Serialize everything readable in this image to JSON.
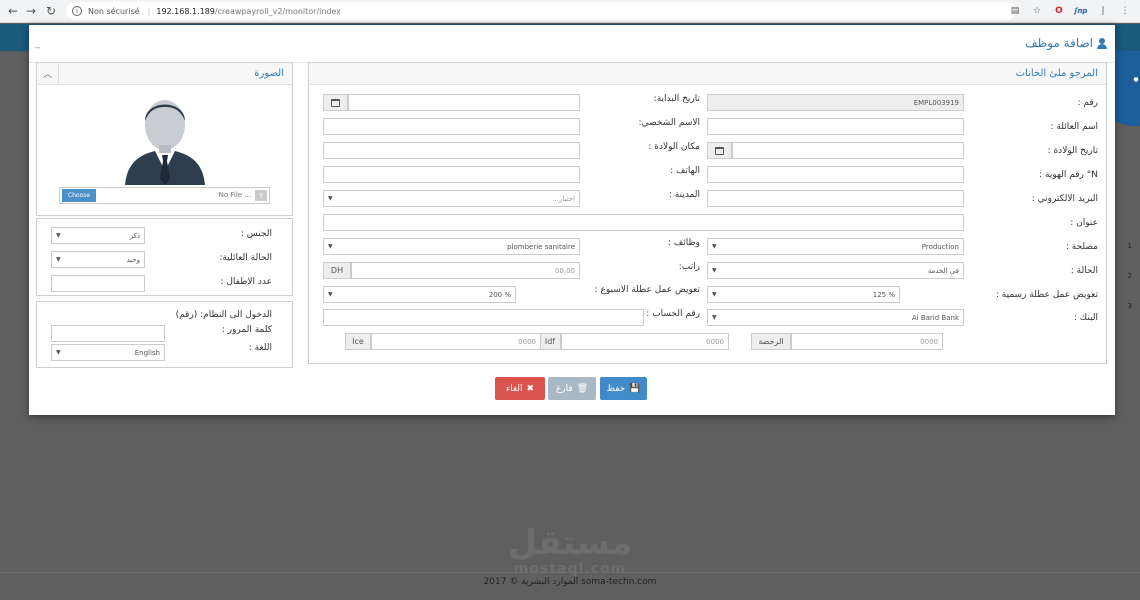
{
  "browser": {
    "back": "←",
    "forward": "→",
    "reload": "↻",
    "insecure": "Non sécurisé",
    "host": "192.168.1.189",
    "path": "/creawpayroll_v2/monitor/index"
  },
  "background": {
    "footer_text": "الموارد البشرية © 2017 soma-techn.com",
    "side_numbers": [
      "1",
      "2",
      "3"
    ],
    "watermark_ar": "مستقل",
    "watermark_lat": "mostaql.com"
  },
  "modal": {
    "title": "اضافة موظف",
    "minimize": "_",
    "main_panel_title": "المرجو ملئ الخانات",
    "photo_panel_title": "الصورة",
    "choose_label": "Choose",
    "no_file_label": "No File ...",
    "fields": {
      "number_label": "رقم :",
      "number_value": "EMPL003919",
      "start_date_label": "تاريخ البداية:",
      "family_name_label": "اسم العائلة :",
      "first_name_label": "الاسم الشخصي:",
      "birth_date_label": "تاريخ الولادة :",
      "birth_place_label": "مكان الولادة :",
      "id_number_label": "N° رقم الهوية :",
      "phone_label": "الهاتف :",
      "email_label": "البريد الالكتروني :",
      "city_label": "المدينة :",
      "city_placeholder": "...اختيار",
      "address_label": "عنوان :",
      "department_label": "مصلحة :",
      "department_value": "Production",
      "job_label": "وظائف :",
      "job_value": "plomberie sanitaire",
      "status_label": "الحالة :",
      "status_value": "في الخدمة",
      "salary_label": "راتب:",
      "salary_value": "00,00",
      "currency": "DH",
      "holiday_comp_label": "تعويض عمل عطلة رسمية :",
      "holiday_comp_value": "125 %",
      "weekend_comp_label": "تعويض عمل عطلة الاسبوع :",
      "weekend_comp_value": "200 %",
      "bank_label": "البنك :",
      "bank_value": "Al Barid Bank",
      "account_label": "رقم الحساب :",
      "license_label": "الرخصة",
      "license_value": "0000",
      "idf_label": "Idf",
      "idf_value": "0000",
      "ice_label": "Ice",
      "ice_value": "0000"
    },
    "info": {
      "gender_label": "الجنس :",
      "gender_value": "ذكر",
      "marital_label": "الحالة العائلية:",
      "marital_value": "وحيد",
      "children_label": "عدد الاطفال :"
    },
    "login": {
      "login_label": "الدخول الى النظام: (رقم)",
      "password_label": "كلمة المرور :",
      "language_label": "اللغة :",
      "language_value": "English"
    },
    "buttons": {
      "save": "حفظ",
      "empty": "فارغ",
      "cancel": "الغاء"
    }
  }
}
